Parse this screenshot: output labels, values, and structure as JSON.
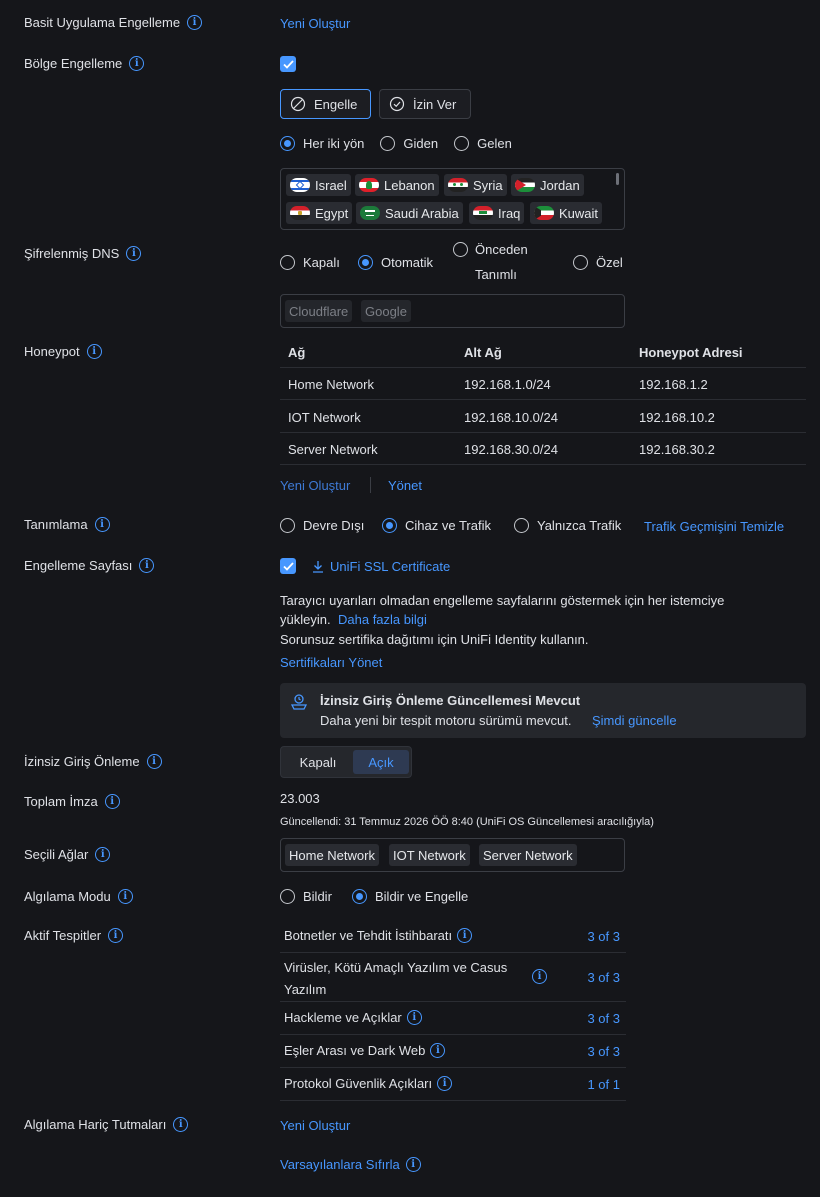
{
  "app_block": {
    "label": "Basit Uygulama Engelleme",
    "create": "Yeni Oluştur"
  },
  "region_block": {
    "label": "Bölge Engelleme",
    "block_btn": "Engelle",
    "allow_btn": "İzin Ver",
    "directions": [
      "Her iki yön",
      "Giden",
      "Gelen"
    ],
    "countries": [
      "Israel",
      "Lebanon",
      "Syria",
      "Jordan",
      "Egypt",
      "Saudi Arabia",
      "Iraq",
      "Kuwait"
    ]
  },
  "dns": {
    "label": "Şifrelenmiş DNS",
    "options": [
      "Kapalı",
      "Otomatik",
      "Önceden",
      "Tanımlı",
      "Özel"
    ],
    "servers": [
      "Cloudflare",
      "Google"
    ]
  },
  "honeypot": {
    "label": "Honeypot",
    "headers": [
      "Ağ",
      "Alt Ağ",
      "Honeypot Adresi"
    ],
    "rows": [
      [
        "Home Network",
        "192.168.1.0/24",
        "192.168.1.2"
      ],
      [
        "IOT Network",
        "192.168.10.0/24",
        "192.168.10.2"
      ],
      [
        "Server Network",
        "192.168.30.0/24",
        "192.168.30.2"
      ]
    ],
    "create": "Yeni Oluştur",
    "manage": "Yönet"
  },
  "identification": {
    "label": "Tanımlama",
    "options": [
      "Devre Dışı",
      "Cihaz ve Trafik",
      "Yalnızca Trafik"
    ],
    "clear": "Trafik Geçmişini Temizle"
  },
  "block_page": {
    "label": "Engelleme Sayfası",
    "cert": "UniFi SSL Certificate",
    "desc1": "Tarayıcı uyarıları olmadan engelleme sayfalarını göstermek için her istemciye",
    "desc2": "yükleyin.",
    "more": "Daha fazla bilgi",
    "desc3": "Sorunsuz sertifika dağıtımı için UniFi Identity kullanın.",
    "manage_certs": "Sertifikaları Yönet"
  },
  "update_banner": {
    "title": "İzinsiz Giriş Önleme Güncellemesi Mevcut",
    "text": "Daha yeni bir tespit motoru sürümü mevcut.",
    "action": "Şimdi güncelle"
  },
  "ips": {
    "label": "İzinsiz Giriş Önleme",
    "off": "Kapalı",
    "on": "Açık"
  },
  "signatures": {
    "label": "Toplam İmza",
    "value": "23.003",
    "updated": "Güncellendi: 31 Temmuz 2026 ÖÖ 8:40 (UniFi OS Güncellemesi aracılığıyla)"
  },
  "networks": {
    "label": "Seçili Ağlar",
    "items": [
      "Home Network",
      "IOT Network",
      "Server Network"
    ]
  },
  "detection_mode": {
    "label": "Algılama Modu",
    "options": [
      "Bildir",
      "Bildir ve Engelle"
    ]
  },
  "active_detections": {
    "label": "Aktif Tespitler",
    "rows": [
      {
        "name": "Botnetler ve Tehdit İstihbaratı",
        "count": "3 of 3"
      },
      {
        "name": "Virüsler, Kötü Amaçlı Yazılım ve Casus",
        "name2": "Yazılım",
        "count": "3 of 3"
      },
      {
        "name": "Hackleme ve Açıklar",
        "count": "3 of 3"
      },
      {
        "name": "Eşler Arası ve Dark Web",
        "count": "3 of 3"
      },
      {
        "name": "Protokol Güvenlik Açıkları",
        "count": "1 of 1"
      }
    ]
  },
  "exclusions": {
    "label": "Algılama Hariç Tutmaları",
    "create": "Yeni Oluştur"
  },
  "reset": "Varsayılanlara Sıfırla",
  "colors": {
    "accent": "#4797ff",
    "bg": "#15161a",
    "panel": "#25272c"
  }
}
